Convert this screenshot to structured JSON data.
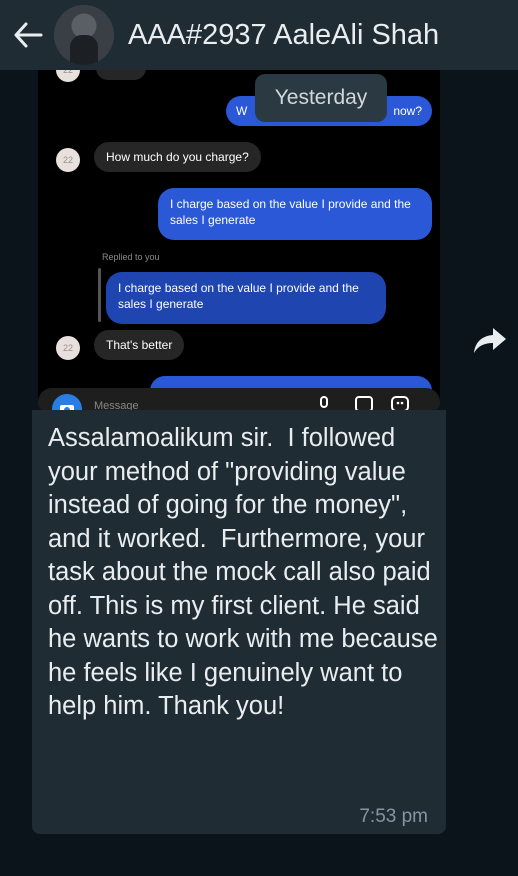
{
  "header": {
    "contact_name": "AAA#2937 AaleAli Shah",
    "back_icon": "back-arrow-icon"
  },
  "screenshot": {
    "date_chip": "Yesterday",
    "partial_out_left": "W",
    "partial_out_right": "now?",
    "incoming_question": "How much do you charge?",
    "outgoing_answer": "I charge based on the value I provide and the sales I generate",
    "replied_label": "Replied to you",
    "reply_quote": "I charge based on the value I provide and the sales I generate",
    "incoming_reply": "That's better",
    "composer_placeholder": "Message",
    "avatar_initials": "22"
  },
  "message": {
    "text": "Assalamoalikum sir.  I followed your method of \"providing value instead of going for the money\", and it worked.  Furthermore, your task about the mock call also paid off. This is my first client. He said he wants to work with me because he feels like I genuinely want to help him. Thank you!",
    "time": "7:53 pm"
  },
  "colors": {
    "header_bg": "#1f2c34",
    "bubble_bg": "#1f2c34",
    "app_bg": "#0b141a",
    "insta_blue": "#2a58d6"
  }
}
